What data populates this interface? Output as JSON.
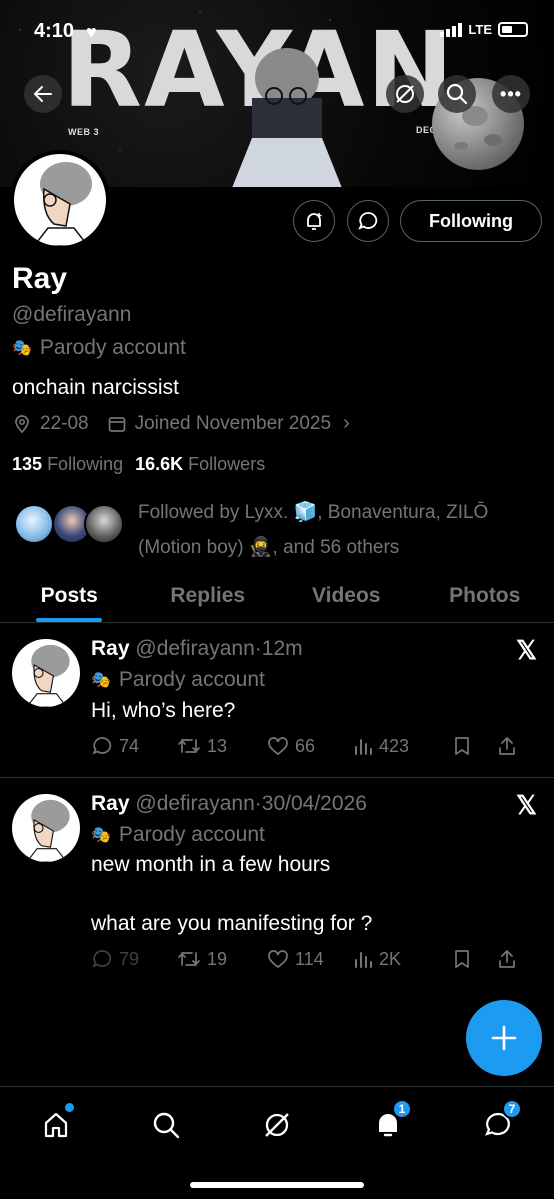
{
  "status": {
    "time": "4:10",
    "network": "LTE"
  },
  "banner": {
    "word": "RAYAN",
    "left_tag": "WEB 3",
    "right_tag": "DEGEN"
  },
  "profile": {
    "name": "Ray",
    "handle": "@defirayann",
    "parody_label": "Parody account",
    "bio": "onchain narcissist",
    "location": "22-08",
    "joined": "Joined November 2025",
    "following_count": "135",
    "following_label": "Following",
    "followers_count": "16.6K",
    "followers_label": "Followers",
    "followed_by_line1": "Followed by Lyxx. 🧊, Bonaventura, ZILŌ",
    "followed_by_line2": "(Motion boy) 🥷, and 56 others",
    "follow_button": "Following"
  },
  "tabs": [
    {
      "label": "Posts",
      "active": true
    },
    {
      "label": "Replies",
      "active": false
    },
    {
      "label": "Videos",
      "active": false
    },
    {
      "label": "Photos",
      "active": false
    }
  ],
  "posts": [
    {
      "name": "Ray",
      "handle": "@defirayann",
      "time": "12m",
      "parody": "Parody account",
      "text": "Hi, who’s here?",
      "replies": "74",
      "reposts": "13",
      "likes": "66",
      "views": "423"
    },
    {
      "name": "Ray",
      "handle": "@defirayann",
      "time": "30/04/2026",
      "parody": "Parody account",
      "text_line1": "new month in a few hours",
      "text_line2": "what are you manifesting for ?",
      "replies": "79",
      "reposts": "19",
      "likes": "114",
      "views": "2K"
    }
  ],
  "nav": {
    "notifications_badge": "1",
    "messages_badge": "7"
  },
  "colors": {
    "accent": "#1d9bf0",
    "muted": "#71767b",
    "background": "#000000"
  }
}
